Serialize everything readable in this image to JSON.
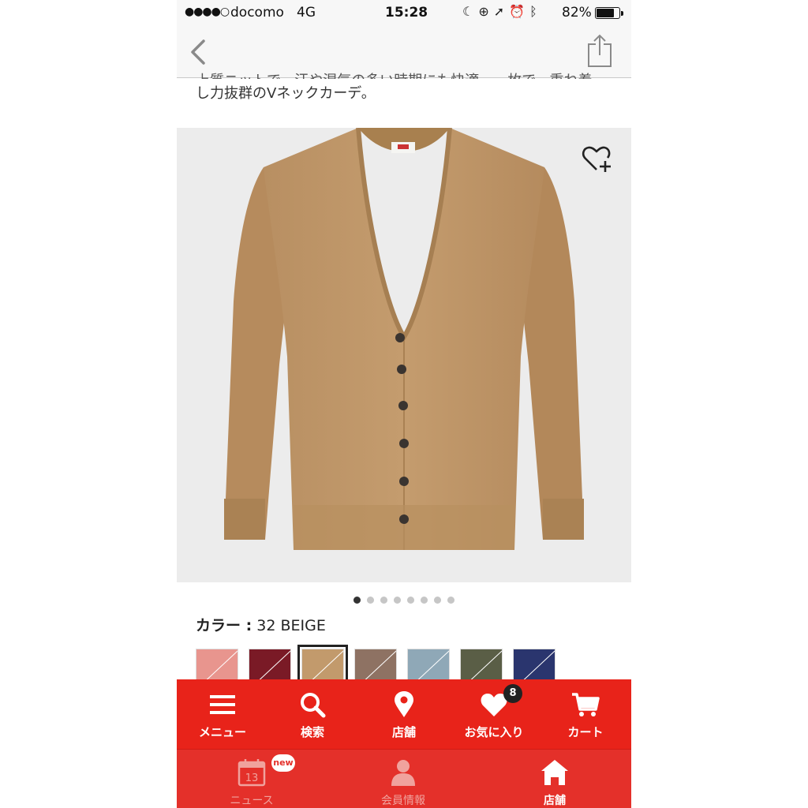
{
  "status_bar": {
    "signal": "●●●●○",
    "carrier": "docomo",
    "network": "4G",
    "time": "15:28",
    "icons": [
      "moon-icon",
      "rotation-lock-icon",
      "location-icon",
      "alarm-icon",
      "bluetooth-icon"
    ],
    "battery": "82%",
    "battery_level": 0.82
  },
  "description": {
    "truncated_line": "上質ニットで、汗や湿気の多い時期にも快適。一枚で、重ね着にも。合わせ",
    "line": "し力抜群のVネックカーデ。"
  },
  "carousel": {
    "total": 8,
    "active_index": 0
  },
  "color_selection": {
    "label": "カラー :",
    "value": "32 BEIGE"
  },
  "swatches": [
    {
      "color": "#e8958e"
    },
    {
      "color": "#7a1a26"
    },
    {
      "color": "#c29a6c",
      "selected": true
    },
    {
      "color": "#8e7263"
    },
    {
      "color": "#8fa8b7"
    },
    {
      "color": "#5a5e46"
    },
    {
      "color": "#2a356e"
    }
  ],
  "menu": {
    "items": [
      {
        "label": "メニュー",
        "icon": "hamburger-icon"
      },
      {
        "label": "検索",
        "icon": "search-icon"
      },
      {
        "label": "店舗",
        "icon": "location-pin-icon"
      },
      {
        "label": "お気に入り",
        "icon": "heart-icon",
        "badge": "8"
      },
      {
        "label": "カート",
        "icon": "cart-icon"
      }
    ]
  },
  "tabs": [
    {
      "label": "ニュース",
      "icon": "calendar-icon",
      "icon_text": "13",
      "badge": "new"
    },
    {
      "label": "会員情報",
      "icon": "person-icon"
    },
    {
      "label": "店舗",
      "icon": "home-icon"
    }
  ],
  "colors": {
    "brand_red": "#e8231a",
    "product_beige": "#c29a6c"
  }
}
